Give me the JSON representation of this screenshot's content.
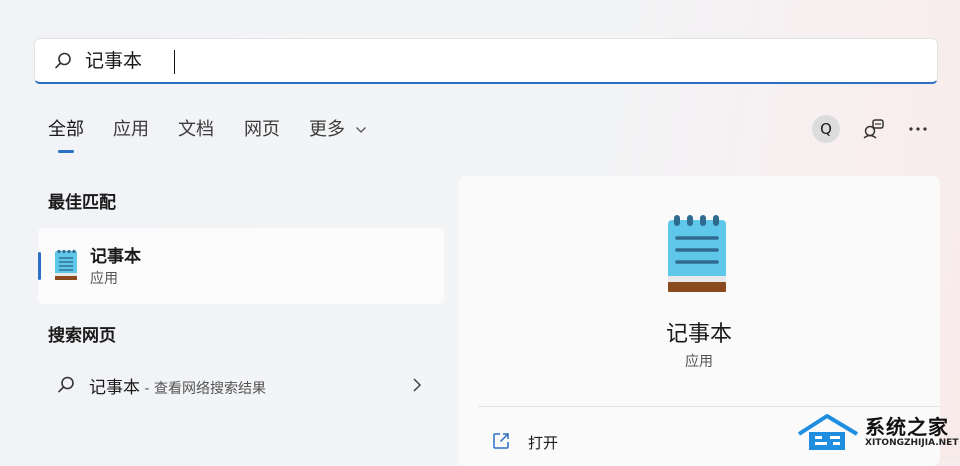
{
  "search": {
    "query": "记事本"
  },
  "tabs": [
    {
      "label": "全部",
      "active": true
    },
    {
      "label": "应用"
    },
    {
      "label": "文档"
    },
    {
      "label": "网页"
    },
    {
      "label": "更多"
    }
  ],
  "toolbar": {
    "avatar_letter": "Q",
    "icons": [
      "search-icon",
      "feedback-icon",
      "more-icon"
    ]
  },
  "best_match": {
    "section_title": "最佳匹配",
    "app_name": "记事本",
    "app_kind": "应用"
  },
  "web_search": {
    "section_title": "搜索网页",
    "query": "记事本",
    "suffix": " - 查看网络搜索结果"
  },
  "detail": {
    "title": "记事本",
    "kind": "应用",
    "actions": [
      {
        "label": "打开",
        "icon": "open-external-icon"
      }
    ]
  },
  "watermark": {
    "title": "系统之家",
    "url": "XITONGZHIJIA.NET"
  },
  "colors": {
    "accent": "#2c6fc4",
    "notepad_body": "#5fc7e9",
    "notepad_base": "#8a4a1e"
  }
}
